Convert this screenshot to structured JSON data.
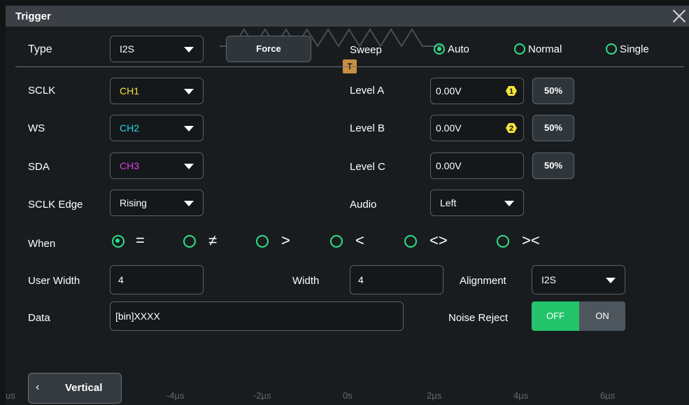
{
  "title": "Trigger",
  "type": {
    "label": "Type",
    "value": "I2S"
  },
  "force_label": "Force",
  "sweep": {
    "label": "Sweep",
    "options": [
      "Auto",
      "Normal",
      "Single"
    ],
    "selected": "Auto"
  },
  "sclk": {
    "label": "SCLK",
    "value": "CH1",
    "color": "#f5e33a"
  },
  "ws": {
    "label": "WS",
    "value": "CH2",
    "color": "#26d9e6"
  },
  "sda": {
    "label": "SDA",
    "value": "CH3",
    "color": "#e23be0"
  },
  "sclk_edge": {
    "label": "SCLK Edge",
    "value": "Rising"
  },
  "level_a": {
    "label": "Level A",
    "value": "0.00V",
    "badge": "1",
    "badge_color": "#f5e33a"
  },
  "level_b": {
    "label": "Level B",
    "value": "0.00V",
    "badge": "2",
    "badge_color": "#f5e33a"
  },
  "level_c": {
    "label": "Level C",
    "value": "0.00V"
  },
  "percent_label": "50%",
  "audio": {
    "label": "Audio",
    "value": "Left"
  },
  "when": {
    "label": "When",
    "options": [
      "=",
      "≠",
      ">",
      "<",
      "<>",
      "><"
    ],
    "selected": "="
  },
  "user_width": {
    "label": "User Width",
    "value": "4"
  },
  "width": {
    "label": "Width",
    "value": "4"
  },
  "alignment": {
    "label": "Alignment",
    "value": "I2S"
  },
  "data": {
    "label": "Data",
    "value": "[bin]XXXX"
  },
  "noise_reject": {
    "label": "Noise Reject",
    "off_label": "OFF",
    "on_label": "ON",
    "state": "OFF"
  },
  "vertical_button": "Vertical",
  "trigger_marker": "T",
  "time_ticks": [
    "us",
    "-4µs",
    "-2µs",
    "0s",
    "2µs",
    "4µs",
    "6µs"
  ],
  "accent_color": "#2ee08a"
}
